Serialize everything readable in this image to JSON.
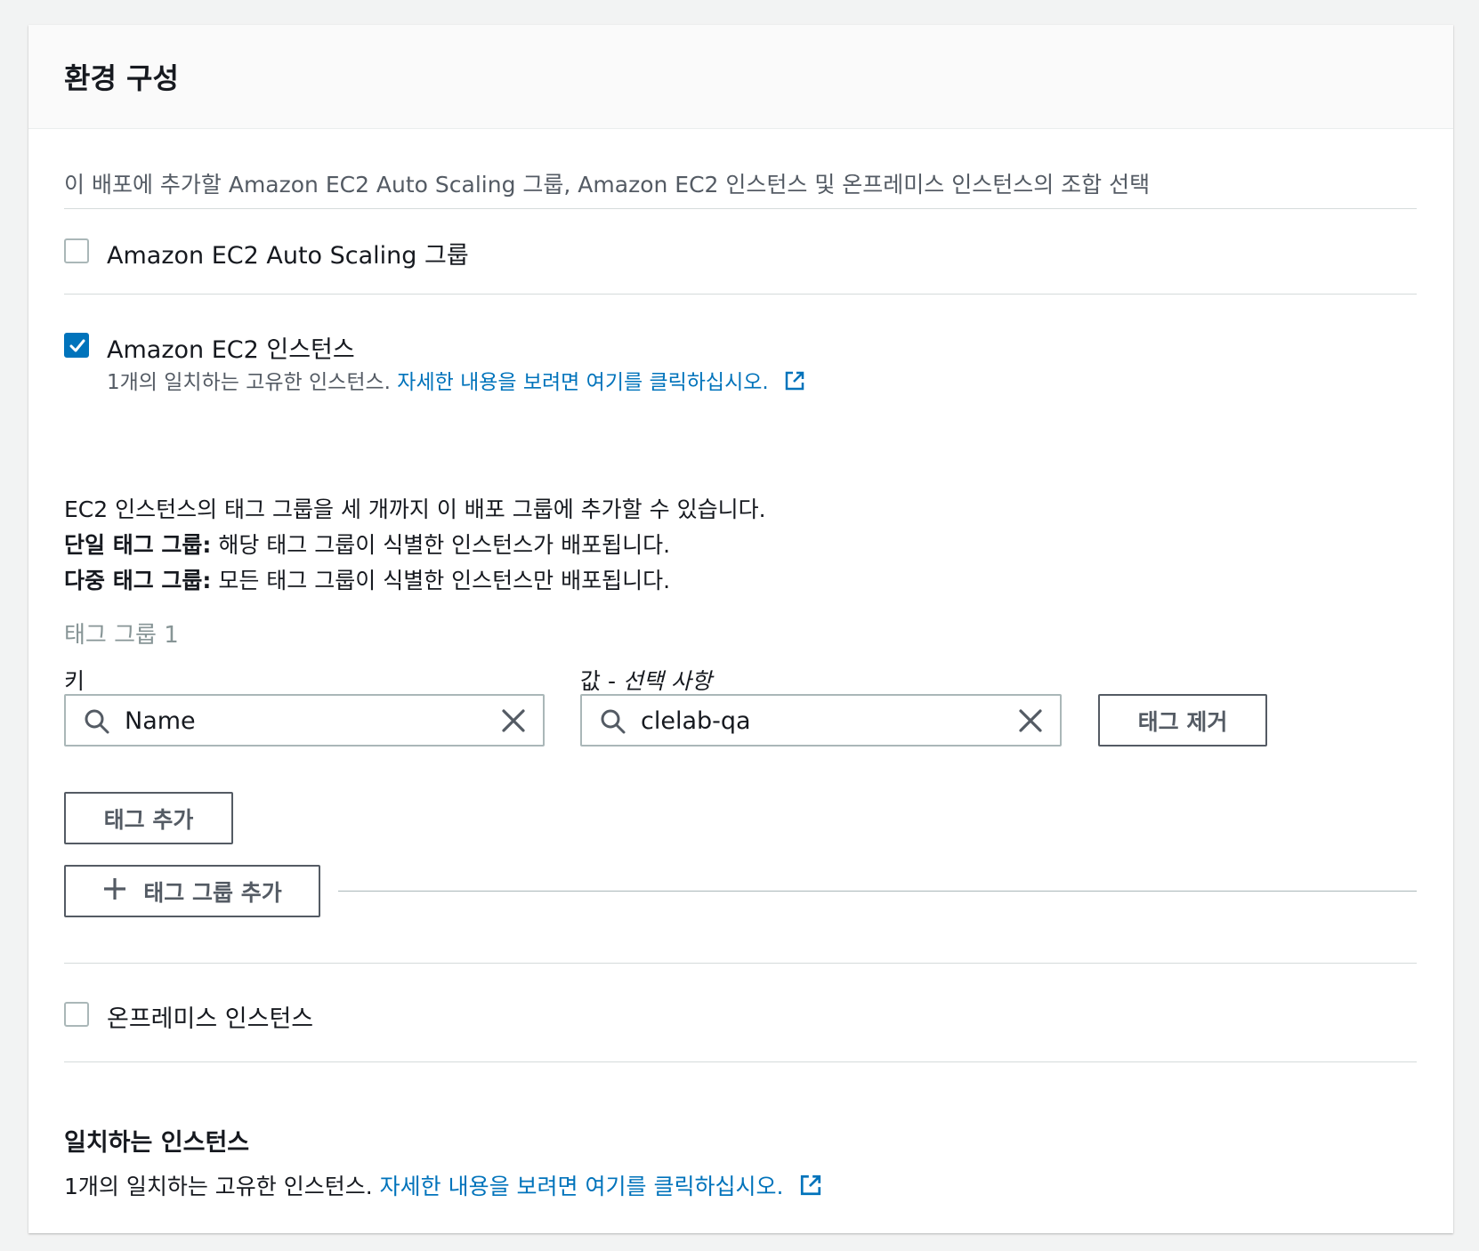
{
  "panel": {
    "title": "환경 구성",
    "description": "이 배포에 추가할 Amazon EC2 Auto Scaling 그룹, Amazon EC2 인스턴스 및 온프레미스 인스턴스의 조합 선택"
  },
  "options": {
    "auto_scaling": {
      "label": "Amazon EC2 Auto Scaling 그룹",
      "checked": false
    },
    "ec2_instances": {
      "label": "Amazon EC2 인스턴스",
      "checked": true,
      "count_text": "1개의 일치하는 고유한 인스턴스.",
      "link_text": "자세한 내용을 보려면 여기를 클릭하십시오."
    },
    "on_premises": {
      "label": "온프레미스 인스턴스",
      "checked": false
    }
  },
  "tag_info": {
    "line1": "EC2 인스턴스의 태그 그룹을 세 개까지 이 배포 그룹에 추가할 수 있습니다.",
    "line2_bold": "단일 태그 그룹:",
    "line2_rest": " 해당 태그 그룹이 식별한 인스턴스가 배포됩니다.",
    "line3_bold": "다중 태그 그룹:",
    "line3_rest": " 모든 태그 그룹이 식별한 인스턴스만 배포됩니다."
  },
  "tag_group": {
    "label": "태그 그룹 1",
    "key_label": "키",
    "value_label_main": "값 - ",
    "value_label_optional": "선택 사항",
    "key_value": "Name",
    "value_value": "clelab-qa",
    "remove_tag_label": "태그 제거",
    "add_tag_label": "태그 추가",
    "add_tag_group_label": "태그 그룹 추가"
  },
  "matching": {
    "title": "일치하는 인스턴스",
    "count_text": "1개의 일치하는 고유한 인스턴스.",
    "link_text": "자세한 내용을 보려면 여기를 클릭하십시오."
  },
  "colors": {
    "link": "#0073bb",
    "checkbox_checked": "#0073bb",
    "border": "#aab7b8",
    "text": "#16191f"
  }
}
